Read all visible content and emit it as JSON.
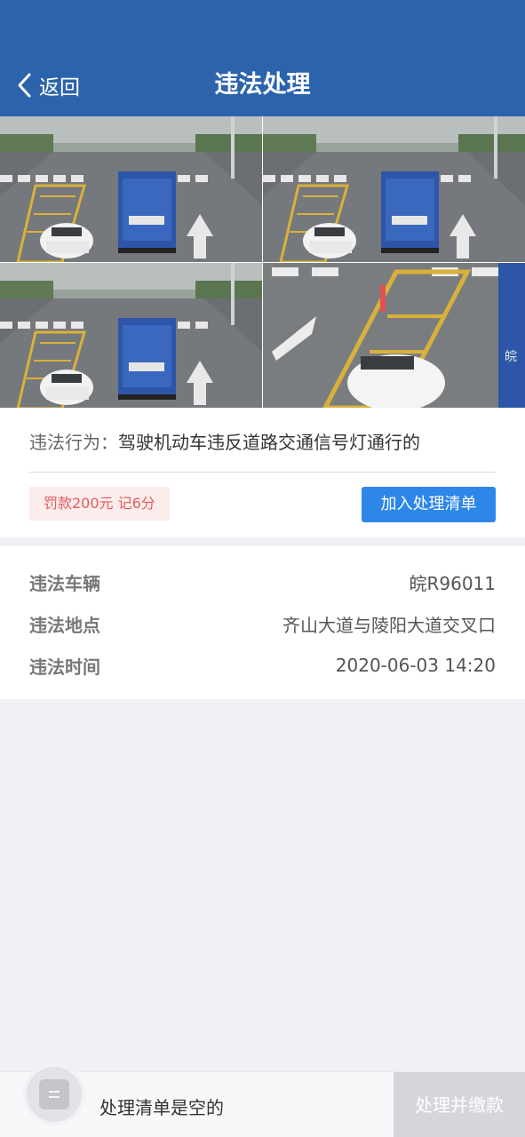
{
  "header": {
    "back_label": "返回",
    "title": "违法处理",
    "color": "#2c63ad"
  },
  "photos": {
    "icon": "traffic-camera-photo",
    "count": 4,
    "plate_text": "皖"
  },
  "violation": {
    "behavior_label": "违法行为：",
    "behavior_text": "驾驶机动车违反道路交通信号灯通行的",
    "penalty": "罚款200元 记6分",
    "add_button": "加入处理清单"
  },
  "details": [
    {
      "key": "违法车辆",
      "value": "皖R96011"
    },
    {
      "key": "违法地点",
      "value": "齐山大道与陵阳大道交叉口"
    },
    {
      "key": "违法时间",
      "value": "2020-06-03 14:20"
    }
  ],
  "bottom": {
    "icon": "list-icon",
    "empty_text": "处理清单是空的",
    "pay_button": "处理并缴款"
  },
  "colors": {
    "accent": "#2c87e8",
    "penalty_text": "#e25c5c",
    "penalty_bg": "#fdecec"
  }
}
